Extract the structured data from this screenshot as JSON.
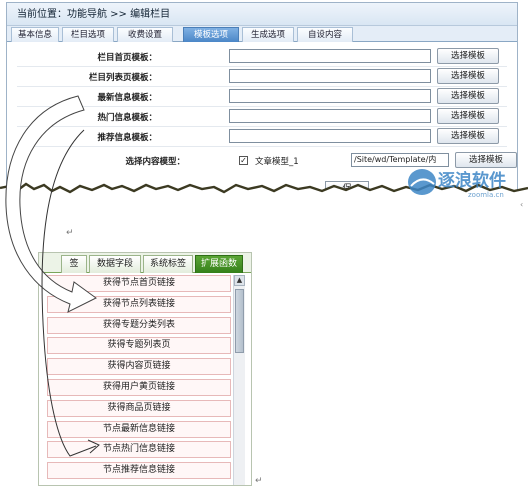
{
  "breadcrumb": {
    "text": "当前位置：功能导航 >> 编辑栏目"
  },
  "tabs": [
    {
      "label": "基本信息"
    },
    {
      "label": "栏目选项"
    },
    {
      "label": "收费设置"
    },
    {
      "label": "模板选项",
      "active": true
    },
    {
      "label": "生成选项"
    },
    {
      "label": "自设内容"
    }
  ],
  "form": {
    "rows": [
      {
        "label": "栏目首页模板：",
        "value": "",
        "button": "选择模板"
      },
      {
        "label": "栏目列表页模板：",
        "value": "",
        "button": "选择模板"
      },
      {
        "label": "最新信息模板：",
        "value": "",
        "button": "选择模板"
      },
      {
        "label": "热门信息模板：",
        "value": "",
        "button": "选择模板"
      },
      {
        "label": "推荐信息模板：",
        "value": "",
        "button": "选择模板"
      }
    ],
    "model_row": {
      "label": "选择内容模型：",
      "checked": true,
      "checkbox_mark": "✓",
      "model_name": "文章模型_1",
      "template_path": "/Site/wd/Template/内",
      "button": "选择模板"
    },
    "save_label": "保"
  },
  "watermark": {
    "text": "逐浪软件",
    "subtext": "zoomla.cn"
  },
  "function_panel": {
    "tabs": [
      {
        "label": "签"
      },
      {
        "label": "数据字段"
      },
      {
        "label": "系统标签"
      },
      {
        "label": "扩展函数",
        "active": true
      }
    ],
    "items": [
      "获得节点首页链接",
      "获得节点列表链接",
      "获得专题分类列表",
      "获得专题列表页",
      "获得内容页链接",
      "获得用户黄页链接",
      "获得商品页链接",
      "节点最新信息链接",
      "节点热门信息链接",
      "节点推荐信息链接"
    ],
    "scroll_up_glyph": "▲"
  },
  "marks": {
    "paragraph": "↵",
    "small": "‹"
  },
  "colors": {
    "active_tab_blue": "#4b86c7",
    "active_tab_green": "#35801a",
    "item_border": "#e7b9b9"
  }
}
